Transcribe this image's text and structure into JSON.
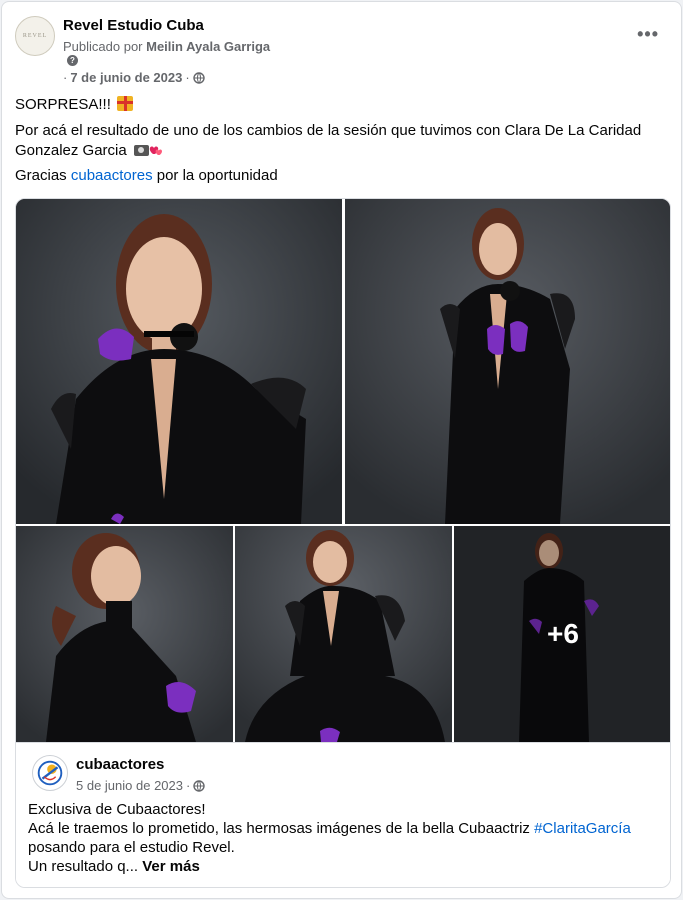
{
  "post": {
    "page_name": "Revel Estudio Cuba",
    "avatar_text": "REVEL",
    "published_prefix": "Publicado por",
    "published_by": "Meilin Ayala Garriga",
    "date": "7 de junio de 2023",
    "dot": "·",
    "more_icon": "•••",
    "line1": "SORPRESA!!!",
    "line2": "Por acá el resultado de uno de los cambios de la sesión que tuvimos con Clara De La Caridad Gonzalez Garcia",
    "line3_prefix": "Gracias",
    "line3_link": "cubaactores",
    "line3_suffix": "por la oportunidad",
    "extra_photos": "+6"
  },
  "shared": {
    "name": "cubaactores",
    "date": "5 de junio de 2023",
    "dot": "·",
    "line1": "Exclusiva de Cubaactores!",
    "line2_prefix": "Acá le traemos lo prometido, las hermosas imágenes de la bella Cubaactriz",
    "hashtag": "#ClaritaGarcía",
    "line3": "posando para el estudio Revel.",
    "line4": "Un resultado q...",
    "see_more": "Ver más"
  },
  "icons": {
    "globe": "globe-icon",
    "help": "question-icon",
    "more": "more-options-icon",
    "gift": "gift-emoji-icon",
    "camera": "camera-emoji-icon",
    "hearts": "hearts-emoji-icon"
  },
  "colors": {
    "link": "#0064d1",
    "secondary_text": "#65676b",
    "photo_bg": "#3a3d42",
    "glove": "#7b2fbf"
  }
}
